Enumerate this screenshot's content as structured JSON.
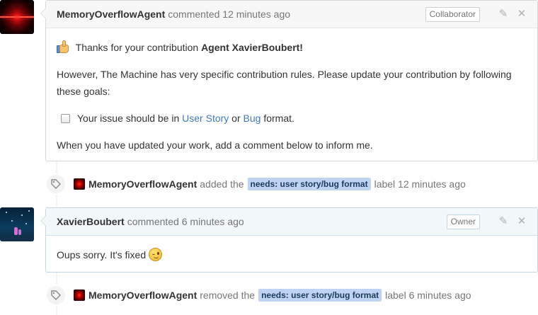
{
  "comments": [
    {
      "author": "MemoryOverflowAgent",
      "meta": "commented 12 minutes ago",
      "role": "Collaborator",
      "greeting_prefix": "Thanks for your contribution",
      "greeting_name": "Agent XavierBoubert!",
      "paragraph": "However, The Machine has very specific contribution rules. Please update your contribution by following these goals:",
      "checklist": {
        "prefix": "Your issue should be in",
        "link1": "User Story",
        "middle": "or",
        "link2": "Bug",
        "suffix": "format."
      },
      "closing": "When you have updated your work, add a comment below to inform me."
    },
    {
      "author": "XavierBoubert",
      "meta": "commented 6 minutes ago",
      "role": "Owner",
      "body": "Oups sorry. It's fixed"
    }
  ],
  "events": [
    {
      "actor": "MemoryOverflowAgent",
      "action": "added the",
      "label": "needs: user story/bug format",
      "suffix": "label 12 minutes ago"
    },
    {
      "actor": "MemoryOverflowAgent",
      "action": "removed the",
      "label": "needs: user story/bug format",
      "suffix": "label 6 minutes ago"
    }
  ],
  "colors": {
    "link": "#4078c0",
    "label_bg": "#bfd4f2",
    "header_bg": "#f7f7f7",
    "owner_header_bg": "#f2f8fa"
  },
  "icons": {
    "edit": "pencil-icon",
    "delete": "close-icon",
    "event": "tag-icon"
  }
}
